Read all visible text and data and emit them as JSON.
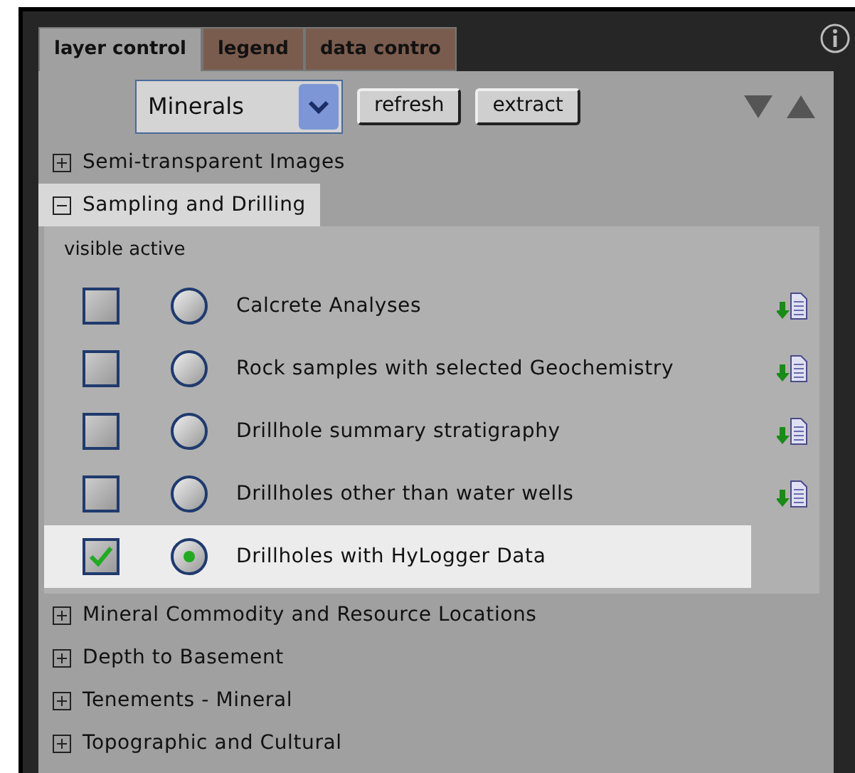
{
  "tabs": [
    {
      "label": "layer control",
      "selected": true
    },
    {
      "label": "legend",
      "selected": false
    },
    {
      "label": "data contro",
      "selected": false
    }
  ],
  "toolbar": {
    "dropdown": {
      "value": "Minerals"
    },
    "buttons": [
      "refresh",
      "extract"
    ]
  },
  "groups": [
    {
      "label": "Semi-transparent Images",
      "expanded": false,
      "selected": false
    },
    {
      "label": "Sampling and Drilling",
      "expanded": true,
      "selected": true,
      "columns_header": "visible active",
      "layers": [
        {
          "label": "Calcrete Analyses",
          "visible": false,
          "active": false,
          "selected": false,
          "download": true
        },
        {
          "label": "Rock samples with selected Geochemistry",
          "visible": false,
          "active": false,
          "selected": false,
          "download": true
        },
        {
          "label": "Drillhole summary stratigraphy",
          "visible": false,
          "active": false,
          "selected": false,
          "download": true
        },
        {
          "label": "Drillholes other than water wells",
          "visible": false,
          "active": false,
          "selected": false,
          "download": true
        },
        {
          "label": "Drillholes with HyLogger Data",
          "visible": true,
          "active": true,
          "selected": true,
          "download": false
        }
      ]
    },
    {
      "label": "Mineral Commodity and Resource Locations",
      "expanded": false,
      "selected": false
    },
    {
      "label": "Depth to Basement",
      "expanded": false,
      "selected": false
    },
    {
      "label": "Tenements - Mineral",
      "expanded": false,
      "selected": false
    },
    {
      "label": "Topographic and Cultural",
      "expanded": false,
      "selected": false
    }
  ]
}
